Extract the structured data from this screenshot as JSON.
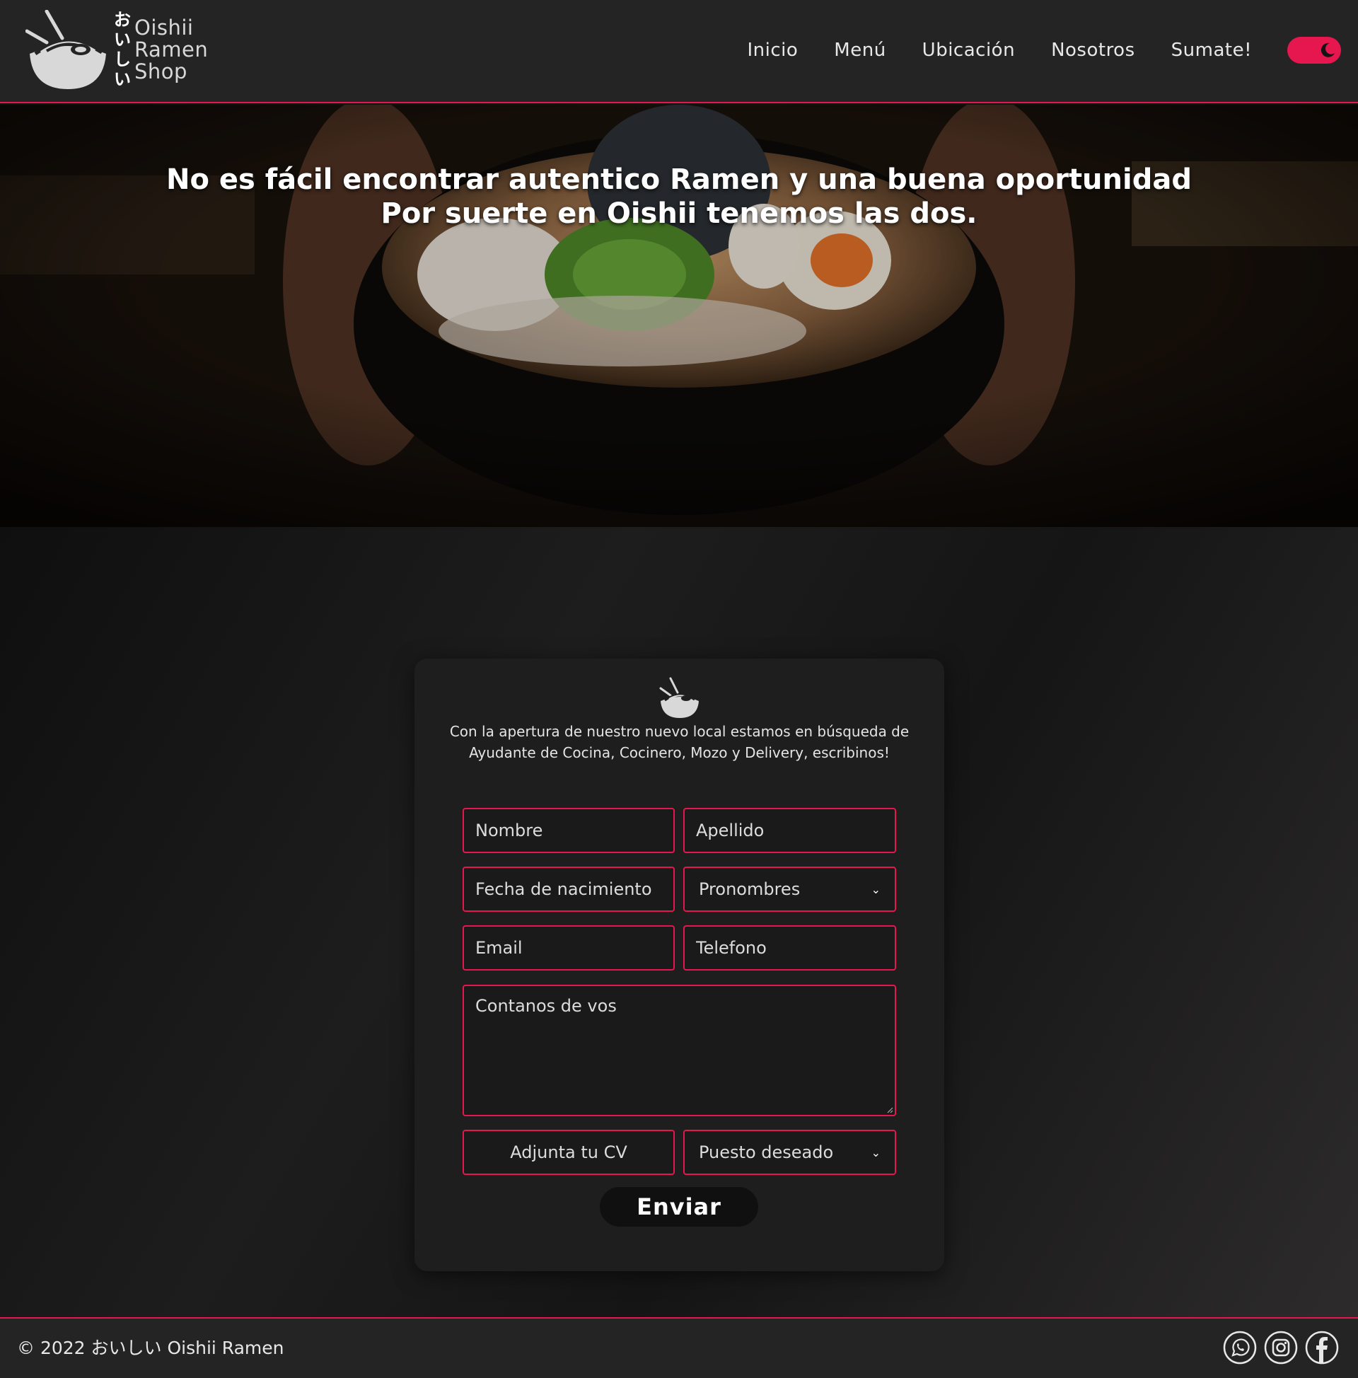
{
  "brand": {
    "kana": [
      "お",
      "い",
      "し",
      "い"
    ],
    "words": [
      "Oishii",
      "Ramen",
      "Shop"
    ]
  },
  "nav": {
    "items": [
      "Inicio",
      "Menú",
      "Ubicación",
      "Nosotros",
      "Sumate!"
    ]
  },
  "theme_toggle": {
    "state": "on",
    "icon": "moon-icon"
  },
  "hero": {
    "line1": "No es fácil encontrar autentico Ramen y una buena oportunidad",
    "line2": "Por suerte en Oishii tenemos las dos."
  },
  "form": {
    "intro": "Con la apertura de nuestro nuevo local estamos en búsqueda de Ayudante de Cocina, Cocinero, Mozo y Delivery, escribinos!",
    "nombre_placeholder": "Nombre",
    "apellido_placeholder": "Apellido",
    "fecha_placeholder": "Fecha de nacimiento",
    "pronombres_label": "Pronombres",
    "email_placeholder": "Email",
    "telefono_placeholder": "Telefono",
    "mensaje_placeholder": "Contanos de vos",
    "cv_label": "Adjunta tu CV",
    "puesto_label": "Puesto deseado",
    "submit_label": "Enviar"
  },
  "footer": {
    "copyright": "© 2022 おいしい Oishii Ramen",
    "socials": [
      "whatsapp-icon",
      "instagram-icon",
      "facebook-icon"
    ]
  },
  "colors": {
    "accent": "#e6164f",
    "header_bg": "#242424",
    "card_bg": "#1e1e1e",
    "text": "#ffffff"
  }
}
